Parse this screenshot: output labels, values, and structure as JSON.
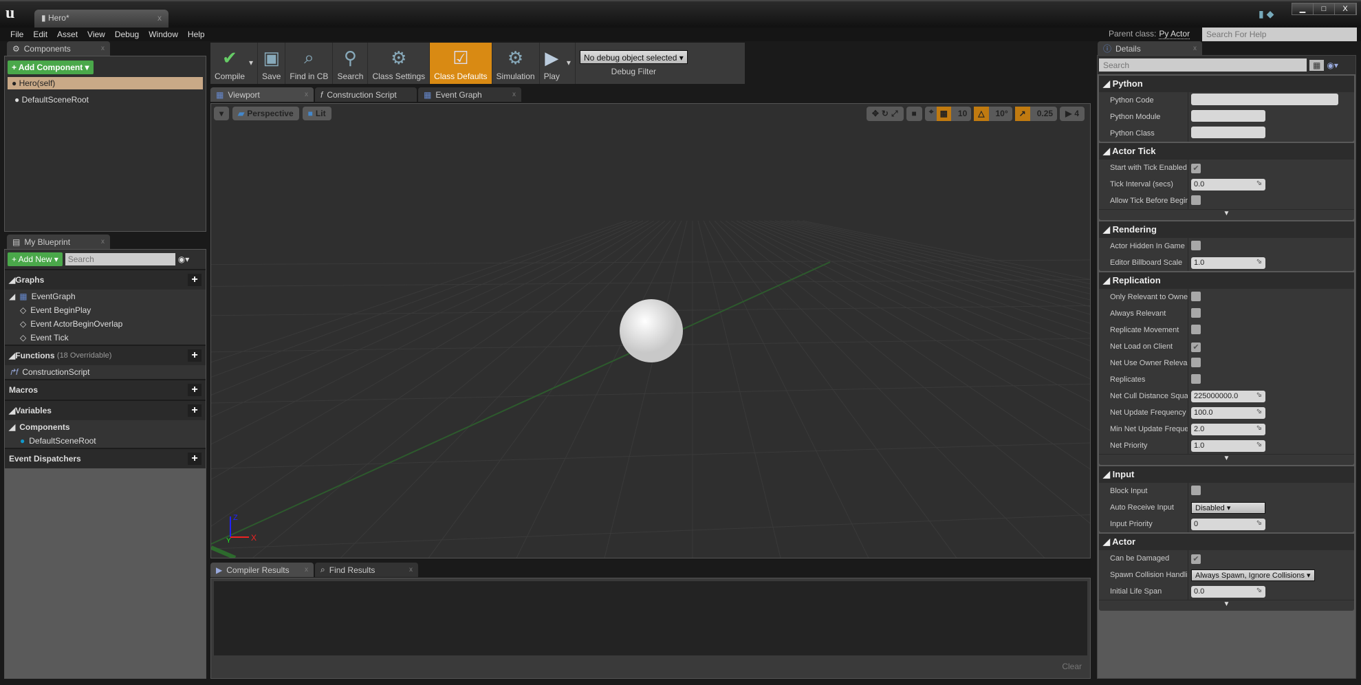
{
  "window": {
    "doc_tab": "Hero*",
    "tab_close": "x",
    "controls": [
      "▁",
      "□",
      "X"
    ]
  },
  "menu": [
    "File",
    "Edit",
    "Asset",
    "View",
    "Debug",
    "Window",
    "Help"
  ],
  "parent_class": {
    "label": "Parent class:",
    "value": "Py Actor"
  },
  "help_search": {
    "placeholder": "Search For Help"
  },
  "components": {
    "tab": "Components",
    "add_button": "+ Add Component ▾",
    "items": [
      "Hero(self)",
      "DefaultSceneRoot"
    ]
  },
  "toolbar": {
    "buttons": [
      "Compile",
      "Save",
      "Find in CB",
      "Search",
      "Class Settings",
      "Class Defaults",
      "Simulation",
      "Play"
    ],
    "active": "Class Defaults",
    "debug_select": "No debug object selected ▾",
    "debug_label": "Debug Filter"
  },
  "editor_tabs": [
    "Viewport",
    "Construction Script",
    "Event Graph"
  ],
  "viewport": {
    "perspective": "Perspective",
    "lit": "Lit",
    "grid_snap": "10",
    "rot_snap": "10°",
    "scale_snap": "0.25",
    "camera_speed": "4",
    "axis": {
      "z": "Z",
      "x": "X",
      "y": "Y"
    }
  },
  "my_blueprint": {
    "tab": "My Blueprint",
    "add_new": "+ Add New ▾",
    "search_placeholder": "Search",
    "graphs": {
      "title": "Graphs",
      "event_graph": "EventGraph",
      "events": [
        "Event BeginPlay",
        "Event ActorBeginOverlap",
        "Event Tick"
      ]
    },
    "functions": {
      "title": "Functions",
      "count": "(18 Overridable)",
      "items": [
        "ConstructionScript"
      ]
    },
    "macros": "Macros",
    "variables": {
      "title": "Variables",
      "components": "Components",
      "items": [
        "DefaultSceneRoot"
      ]
    },
    "dispatchers": "Event Dispatchers"
  },
  "bottom": {
    "tabs": [
      "Compiler Results",
      "Find Results"
    ],
    "clear": "Clear"
  },
  "details": {
    "tab": "Details",
    "search_placeholder": "Search",
    "sections": [
      {
        "title": "Python",
        "rows": [
          {
            "label": "Python Code",
            "type": "text",
            "value": "",
            "wide": true
          },
          {
            "label": "Python Module",
            "type": "text",
            "value": ""
          },
          {
            "label": "Python Class",
            "type": "text",
            "value": ""
          }
        ]
      },
      {
        "title": "Actor Tick",
        "expand": true,
        "rows": [
          {
            "label": "Start with Tick Enabled",
            "type": "check",
            "value": true
          },
          {
            "label": "Tick Interval (secs)",
            "type": "num",
            "value": "0.0"
          },
          {
            "label": "Allow Tick Before BeginPlay",
            "type": "check",
            "value": false
          }
        ]
      },
      {
        "title": "Rendering",
        "rows": [
          {
            "label": "Actor Hidden In Game",
            "type": "check",
            "value": false
          },
          {
            "label": "Editor Billboard Scale",
            "type": "num",
            "value": "1.0"
          }
        ]
      },
      {
        "title": "Replication",
        "expand": true,
        "rows": [
          {
            "label": "Only Relevant to Owner",
            "type": "check",
            "value": false
          },
          {
            "label": "Always Relevant",
            "type": "check",
            "value": false
          },
          {
            "label": "Replicate Movement",
            "type": "check",
            "value": false
          },
          {
            "label": "Net Load on Client",
            "type": "check",
            "value": true
          },
          {
            "label": "Net Use Owner Relevancy",
            "type": "check",
            "value": false
          },
          {
            "label": "Replicates",
            "type": "check",
            "value": false
          },
          {
            "label": "Net Cull Distance Squared",
            "type": "num",
            "value": "225000000.0"
          },
          {
            "label": "Net Update Frequency",
            "type": "num",
            "value": "100.0"
          },
          {
            "label": "Min Net Update Frequency",
            "type": "num",
            "value": "2.0"
          },
          {
            "label": "Net Priority",
            "type": "num",
            "value": "1.0"
          }
        ]
      },
      {
        "title": "Input",
        "rows": [
          {
            "label": "Block Input",
            "type": "check",
            "value": false
          },
          {
            "label": "Auto Receive Input",
            "type": "combo",
            "value": "Disabled"
          },
          {
            "label": "Input Priority",
            "type": "num",
            "value": "0"
          }
        ]
      },
      {
        "title": "Actor",
        "expand": true,
        "rows": [
          {
            "label": "Can be Damaged",
            "type": "check",
            "value": true
          },
          {
            "label": "Spawn Collision Handling Method",
            "type": "combo",
            "value": "Always Spawn, Ignore Collisions"
          },
          {
            "label": "Initial Life Span",
            "type": "num",
            "value": "0.0"
          }
        ]
      }
    ]
  },
  "colors": {
    "accent": "#d98a13",
    "add_green": "#4aa84a",
    "selected_row": "#c9a987"
  }
}
